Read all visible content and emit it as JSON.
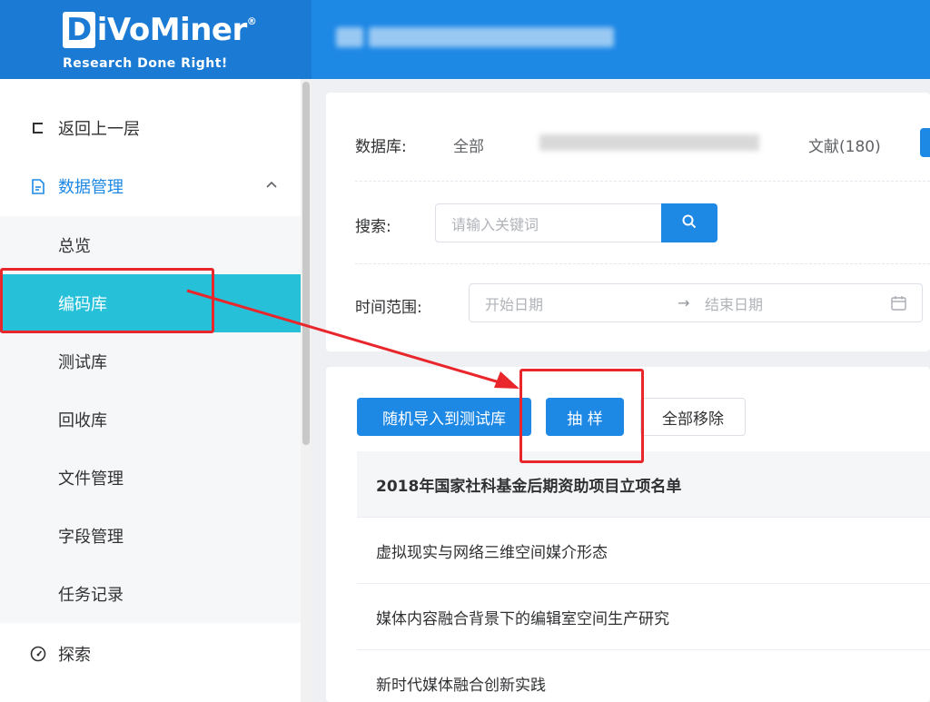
{
  "header": {
    "logo_text": "iVoMiner",
    "logo_initial": "D",
    "logo_mark": "®",
    "tagline": "Research Done Right!"
  },
  "sidebar": {
    "back": {
      "icon": "back-icon",
      "label": "返回上一层"
    },
    "data_mgmt": {
      "icon": "document-icon",
      "label": "数据管理",
      "chevron": "chevron-up-icon"
    },
    "sub_items": [
      {
        "label": "总览"
      },
      {
        "label": "编码库",
        "active": true
      },
      {
        "label": "测试库"
      },
      {
        "label": "回收库"
      },
      {
        "label": "文件管理"
      },
      {
        "label": "字段管理"
      },
      {
        "label": "任务记录"
      }
    ],
    "explore": {
      "icon": "dashboard-icon",
      "label": "探索"
    }
  },
  "filters": {
    "database_label": "数据库:",
    "database_all": "全部",
    "database_literature": "文献(180)",
    "search_label": "搜索:",
    "search_placeholder": "请输入关键词",
    "time_label": "时间范围:",
    "start_placeholder": "开始日期",
    "range_arrow": "→",
    "end_placeholder": "结束日期"
  },
  "actions": {
    "random_import": "随机导入到测试库",
    "sample": "抽 样",
    "remove_all": "全部移除"
  },
  "list": [
    "2018年国家社科基金后期资助项目立项名单",
    "虚拟现实与网络三维空间媒介形态",
    "媒体内容融合背景下的编辑室空间生产研究",
    "新时代媒体融合创新实践"
  ],
  "colors": {
    "primary": "#1e88e5",
    "active_nav": "#26c0d9",
    "annotation": "#e8262b"
  }
}
